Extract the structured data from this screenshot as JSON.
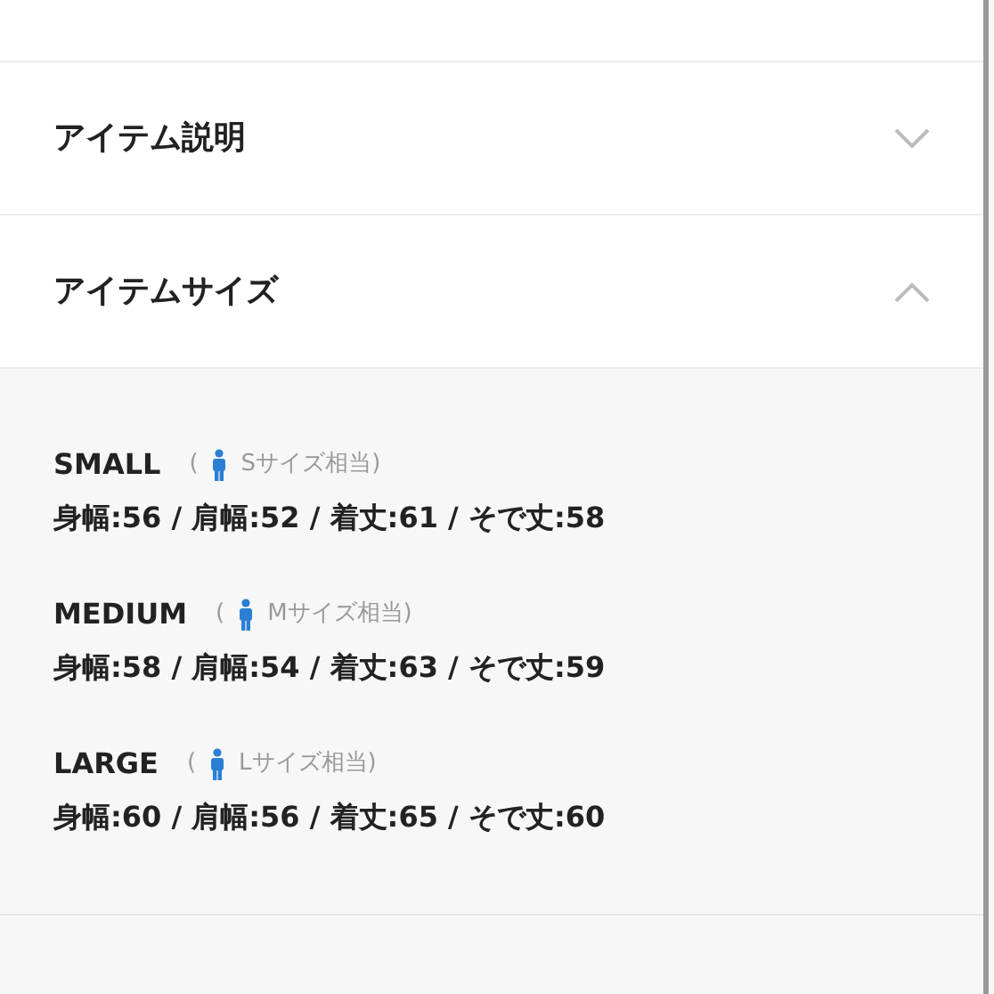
{
  "sections": [
    {
      "title": "アイテム説明",
      "expanded": false
    },
    {
      "title": "アイテムサイズ",
      "expanded": true,
      "sizes": [
        {
          "name": "SMALL",
          "paren_open": "(",
          "note": "Sサイズ相当",
          "paren_close": ")",
          "measurements": "身幅:56 / 肩幅:52 / 着丈:61 / そで丈:58"
        },
        {
          "name": "MEDIUM",
          "paren_open": "(",
          "note": "Mサイズ相当",
          "paren_close": ")",
          "measurements": "身幅:58 / 肩幅:54 / 着丈:63 / そで丈:59"
        },
        {
          "name": "LARGE",
          "paren_open": "(",
          "note": "Lサイズ相当",
          "paren_close": ")",
          "measurements": "身幅:60 / 肩幅:56 / 着丈:65 / そで丈:60"
        }
      ]
    }
  ]
}
